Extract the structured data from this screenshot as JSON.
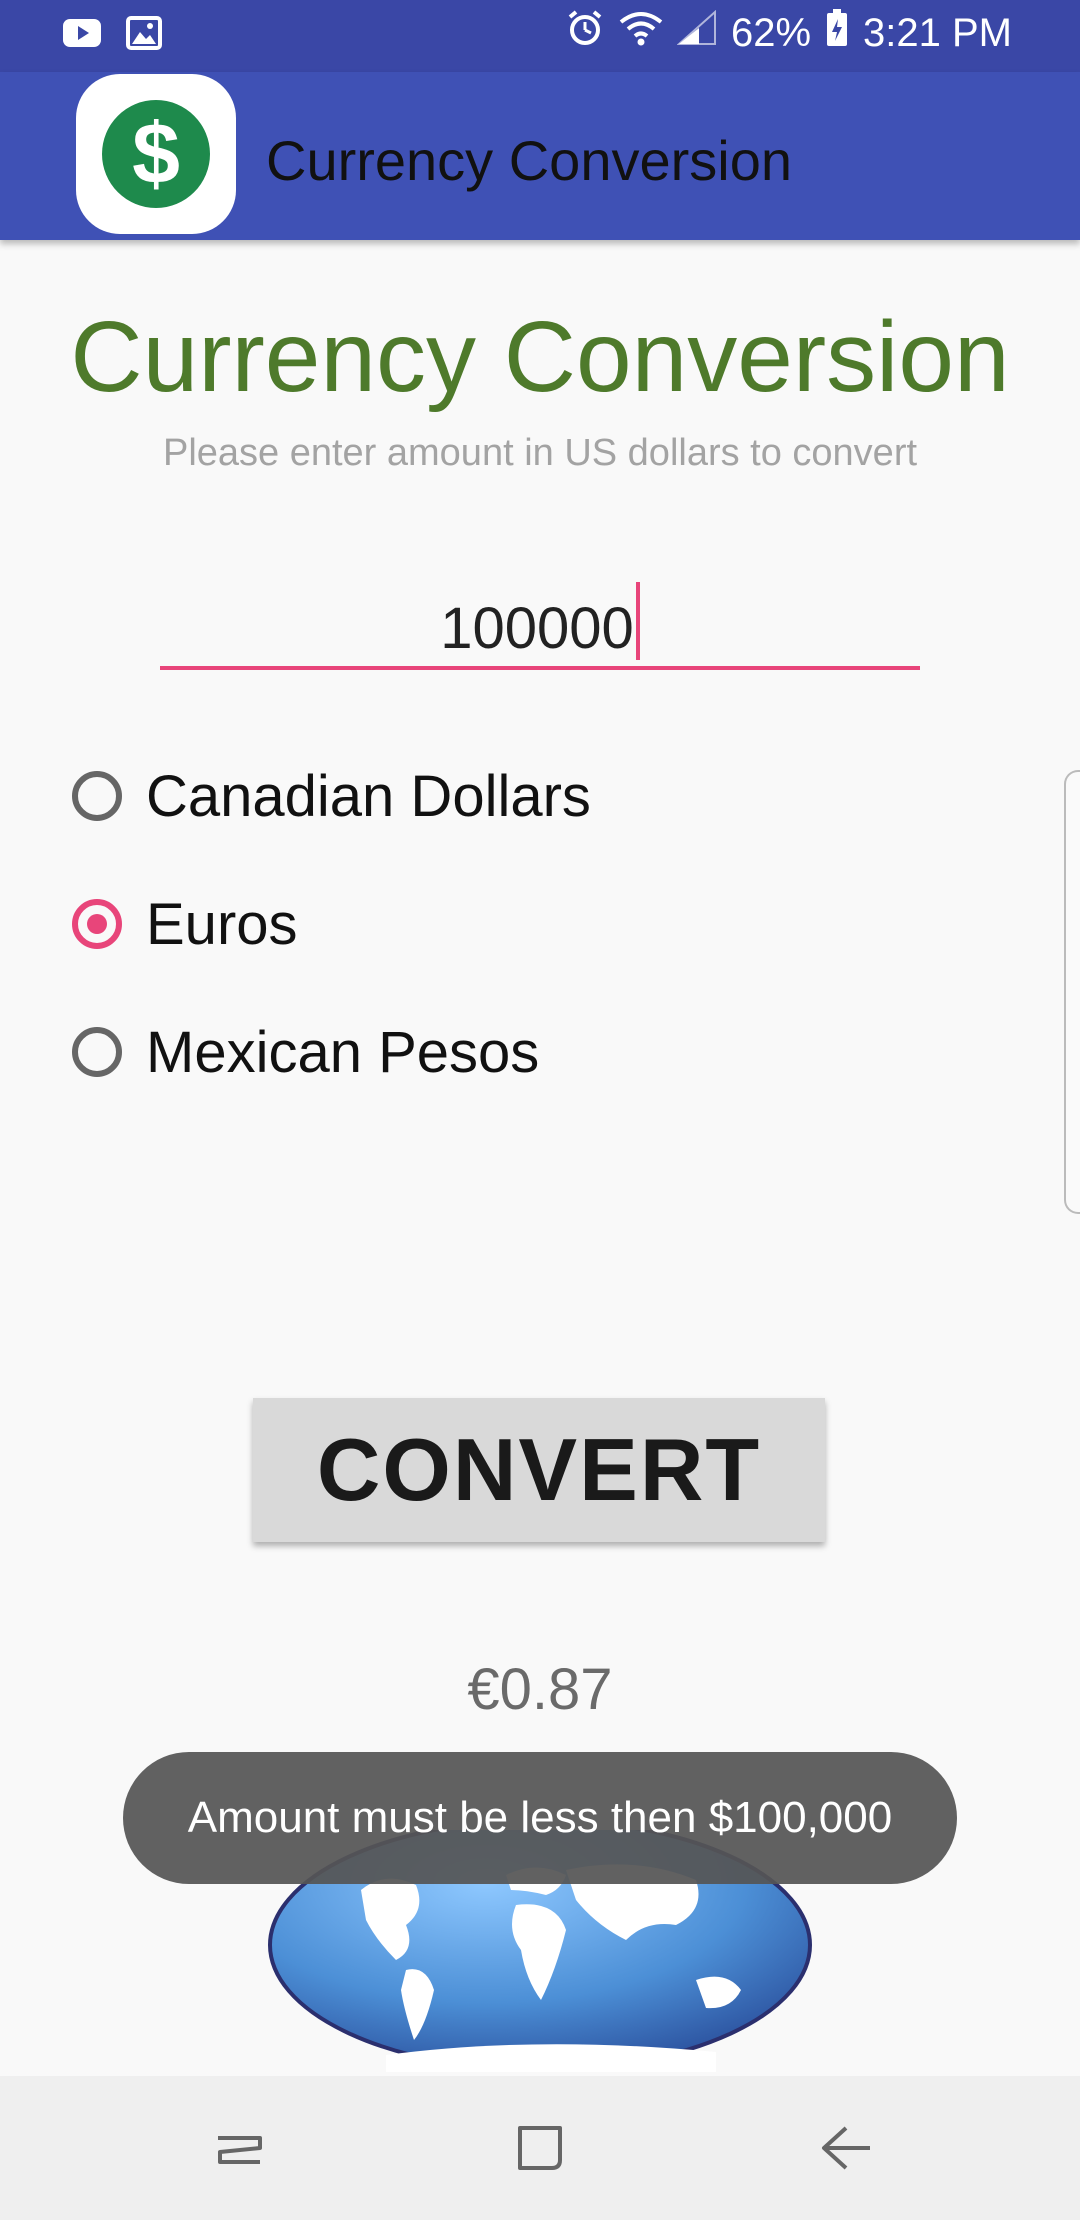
{
  "status_bar": {
    "battery": "62%",
    "time": "3:21 PM",
    "icons": [
      "youtube-icon",
      "gallery-icon",
      "alarm-icon",
      "wifi-icon",
      "signal-icon",
      "battery-icon"
    ]
  },
  "app_bar": {
    "title": "Currency Conversion",
    "icon_symbol": "$"
  },
  "main": {
    "title": "Currency Conversion",
    "subtitle": "Please enter amount in US dollars to convert",
    "amount_input": {
      "value": "100000"
    },
    "currency_options": [
      {
        "label": "Canadian Dollars",
        "checked": false
      },
      {
        "label": "Euros",
        "checked": true
      },
      {
        "label": "Mexican Pesos",
        "checked": false
      }
    ],
    "convert_button": "CONVERT",
    "result": "€0.87"
  },
  "toast": {
    "message": "Amount must be less then $100,000"
  },
  "colors": {
    "status_bar": "#3a47a6",
    "app_bar": "#3f51b5",
    "title_green": "#4e7a2b",
    "accent_pink": "#e8457a"
  },
  "nav_bar": {
    "icons": [
      "recent-apps-icon",
      "home-icon",
      "back-icon"
    ]
  }
}
